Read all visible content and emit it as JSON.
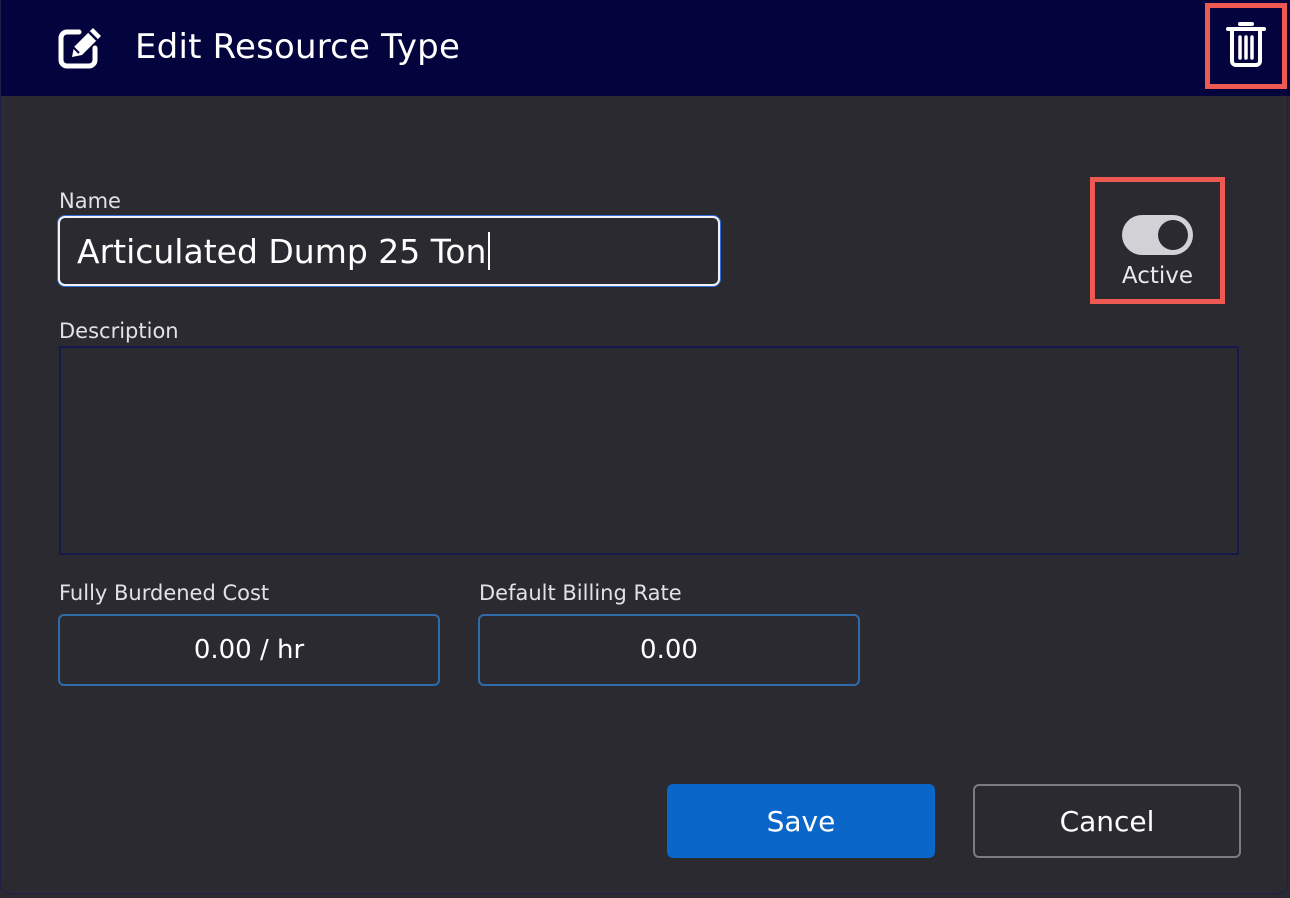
{
  "header": {
    "title": "Edit Resource Type",
    "title_icon": "edit-square-icon",
    "delete_icon": "trash-icon"
  },
  "form": {
    "name": {
      "label": "Name",
      "value": "Articulated Dump 25 Ton"
    },
    "active": {
      "label": "Active",
      "on": true
    },
    "description": {
      "label": "Description",
      "value": ""
    },
    "fully_burdened_cost": {
      "label": "Fully Burdened Cost",
      "value": "0.00 / hr"
    },
    "default_billing_rate": {
      "label": "Default Billing Rate",
      "value": "0.00"
    }
  },
  "buttons": {
    "save": "Save",
    "cancel": "Cancel"
  },
  "colors": {
    "header_bg": "#03033d",
    "body_bg": "#2a2a30",
    "primary": "#0a66c8",
    "highlight": "#ee5a52"
  }
}
